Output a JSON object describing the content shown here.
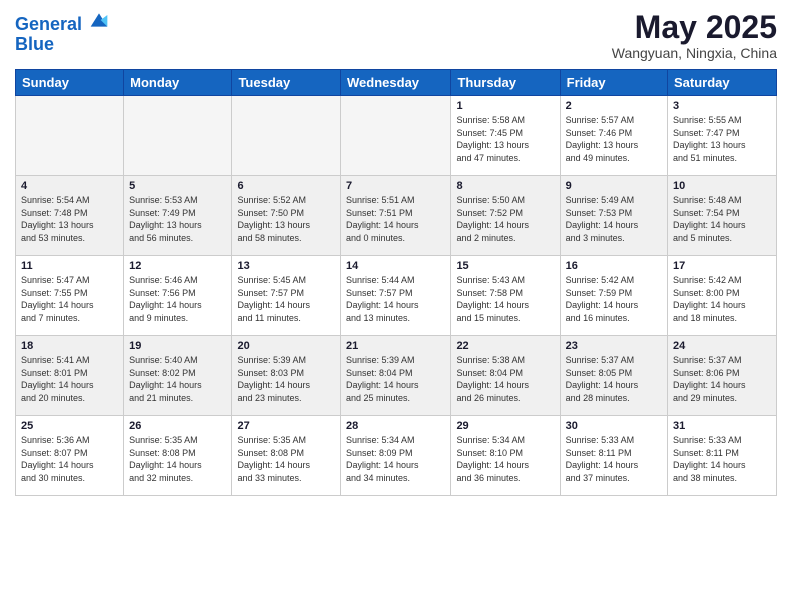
{
  "header": {
    "logo_line1": "General",
    "logo_line2": "Blue",
    "month_title": "May 2025",
    "location": "Wangyuan, Ningxia, China"
  },
  "weekdays": [
    "Sunday",
    "Monday",
    "Tuesday",
    "Wednesday",
    "Thursday",
    "Friday",
    "Saturday"
  ],
  "weeks": [
    [
      {
        "day": "",
        "info": ""
      },
      {
        "day": "",
        "info": ""
      },
      {
        "day": "",
        "info": ""
      },
      {
        "day": "",
        "info": ""
      },
      {
        "day": "1",
        "info": "Sunrise: 5:58 AM\nSunset: 7:45 PM\nDaylight: 13 hours\nand 47 minutes."
      },
      {
        "day": "2",
        "info": "Sunrise: 5:57 AM\nSunset: 7:46 PM\nDaylight: 13 hours\nand 49 minutes."
      },
      {
        "day": "3",
        "info": "Sunrise: 5:55 AM\nSunset: 7:47 PM\nDaylight: 13 hours\nand 51 minutes."
      }
    ],
    [
      {
        "day": "4",
        "info": "Sunrise: 5:54 AM\nSunset: 7:48 PM\nDaylight: 13 hours\nand 53 minutes."
      },
      {
        "day": "5",
        "info": "Sunrise: 5:53 AM\nSunset: 7:49 PM\nDaylight: 13 hours\nand 56 minutes."
      },
      {
        "day": "6",
        "info": "Sunrise: 5:52 AM\nSunset: 7:50 PM\nDaylight: 13 hours\nand 58 minutes."
      },
      {
        "day": "7",
        "info": "Sunrise: 5:51 AM\nSunset: 7:51 PM\nDaylight: 14 hours\nand 0 minutes."
      },
      {
        "day": "8",
        "info": "Sunrise: 5:50 AM\nSunset: 7:52 PM\nDaylight: 14 hours\nand 2 minutes."
      },
      {
        "day": "9",
        "info": "Sunrise: 5:49 AM\nSunset: 7:53 PM\nDaylight: 14 hours\nand 3 minutes."
      },
      {
        "day": "10",
        "info": "Sunrise: 5:48 AM\nSunset: 7:54 PM\nDaylight: 14 hours\nand 5 minutes."
      }
    ],
    [
      {
        "day": "11",
        "info": "Sunrise: 5:47 AM\nSunset: 7:55 PM\nDaylight: 14 hours\nand 7 minutes."
      },
      {
        "day": "12",
        "info": "Sunrise: 5:46 AM\nSunset: 7:56 PM\nDaylight: 14 hours\nand 9 minutes."
      },
      {
        "day": "13",
        "info": "Sunrise: 5:45 AM\nSunset: 7:57 PM\nDaylight: 14 hours\nand 11 minutes."
      },
      {
        "day": "14",
        "info": "Sunrise: 5:44 AM\nSunset: 7:57 PM\nDaylight: 14 hours\nand 13 minutes."
      },
      {
        "day": "15",
        "info": "Sunrise: 5:43 AM\nSunset: 7:58 PM\nDaylight: 14 hours\nand 15 minutes."
      },
      {
        "day": "16",
        "info": "Sunrise: 5:42 AM\nSunset: 7:59 PM\nDaylight: 14 hours\nand 16 minutes."
      },
      {
        "day": "17",
        "info": "Sunrise: 5:42 AM\nSunset: 8:00 PM\nDaylight: 14 hours\nand 18 minutes."
      }
    ],
    [
      {
        "day": "18",
        "info": "Sunrise: 5:41 AM\nSunset: 8:01 PM\nDaylight: 14 hours\nand 20 minutes."
      },
      {
        "day": "19",
        "info": "Sunrise: 5:40 AM\nSunset: 8:02 PM\nDaylight: 14 hours\nand 21 minutes."
      },
      {
        "day": "20",
        "info": "Sunrise: 5:39 AM\nSunset: 8:03 PM\nDaylight: 14 hours\nand 23 minutes."
      },
      {
        "day": "21",
        "info": "Sunrise: 5:39 AM\nSunset: 8:04 PM\nDaylight: 14 hours\nand 25 minutes."
      },
      {
        "day": "22",
        "info": "Sunrise: 5:38 AM\nSunset: 8:04 PM\nDaylight: 14 hours\nand 26 minutes."
      },
      {
        "day": "23",
        "info": "Sunrise: 5:37 AM\nSunset: 8:05 PM\nDaylight: 14 hours\nand 28 minutes."
      },
      {
        "day": "24",
        "info": "Sunrise: 5:37 AM\nSunset: 8:06 PM\nDaylight: 14 hours\nand 29 minutes."
      }
    ],
    [
      {
        "day": "25",
        "info": "Sunrise: 5:36 AM\nSunset: 8:07 PM\nDaylight: 14 hours\nand 30 minutes."
      },
      {
        "day": "26",
        "info": "Sunrise: 5:35 AM\nSunset: 8:08 PM\nDaylight: 14 hours\nand 32 minutes."
      },
      {
        "day": "27",
        "info": "Sunrise: 5:35 AM\nSunset: 8:08 PM\nDaylight: 14 hours\nand 33 minutes."
      },
      {
        "day": "28",
        "info": "Sunrise: 5:34 AM\nSunset: 8:09 PM\nDaylight: 14 hours\nand 34 minutes."
      },
      {
        "day": "29",
        "info": "Sunrise: 5:34 AM\nSunset: 8:10 PM\nDaylight: 14 hours\nand 36 minutes."
      },
      {
        "day": "30",
        "info": "Sunrise: 5:33 AM\nSunset: 8:11 PM\nDaylight: 14 hours\nand 37 minutes."
      },
      {
        "day": "31",
        "info": "Sunrise: 5:33 AM\nSunset: 8:11 PM\nDaylight: 14 hours\nand 38 minutes."
      }
    ]
  ]
}
